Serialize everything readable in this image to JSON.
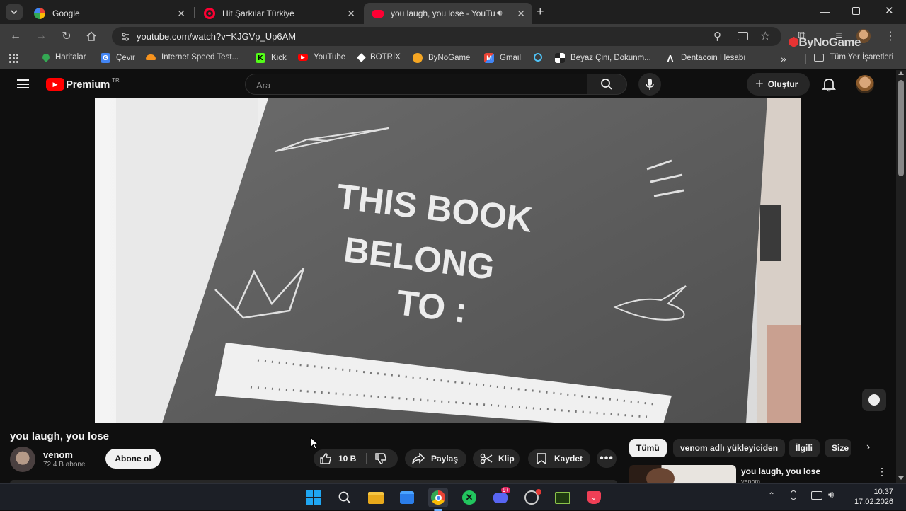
{
  "browser": {
    "tabs": [
      {
        "title": "Google",
        "favicon_color": "#ffffff"
      },
      {
        "title": "Hit Şarkılar Türkiye",
        "favicon_color": "#ff0033"
      },
      {
        "title": "you laugh, you lose - YouTu",
        "favicon_color": "#ff0033"
      }
    ],
    "url": "youtube.com/watch?v=KJGVp_Up6AM",
    "bookmarks": [
      {
        "label": "Haritalar",
        "color": "#34a853"
      },
      {
        "label": "Çevir",
        "color": "#4285f4"
      },
      {
        "label": "Internet Speed Test...",
        "color": "#f7931e"
      },
      {
        "label": "Kick",
        "color": "#53fc18"
      },
      {
        "label": "YouTube",
        "color": "#ff0000"
      },
      {
        "label": "BOTRİX",
        "color": "#ffffff"
      },
      {
        "label": "ByNoGame",
        "color": "#f5a623"
      },
      {
        "label": "Gmail",
        "color": "#ea4335"
      },
      {
        "label": "",
        "color": "#4fc3f7"
      },
      {
        "label": "Beyaz Çini, Dokunm...",
        "color": "#ffffff"
      },
      {
        "label": "Dentacoin Hesabı",
        "color": "#ffffff"
      }
    ],
    "all_bookmarks": "Tüm Yer İşaretleri",
    "extension_watermark": "ByNoGame"
  },
  "youtube": {
    "logo_text": "Premium",
    "region": "TR",
    "search_placeholder": "Ara",
    "create_label": "Oluştur",
    "video_text": {
      "line1": "THIS BOOK",
      "line2": "BELONG",
      "line3": "TO :"
    },
    "title": "you laugh, you lose",
    "channel": {
      "name": "venom",
      "subscribers": "72,4 B abone",
      "subscribe_label": "Abone ol"
    },
    "actions": {
      "likes": "10 B",
      "share": "Paylaş",
      "clip": "Klip",
      "save": "Kaydet"
    },
    "chips": [
      "Tümü",
      "venom adlı yükleyiciden",
      "İlgili",
      "Size"
    ],
    "recommended": {
      "title": "you laugh, you lose",
      "channel": "venom"
    }
  },
  "taskbar": {
    "time": "10:37",
    "date": "17.02.2026",
    "discord_badge": "9+"
  }
}
